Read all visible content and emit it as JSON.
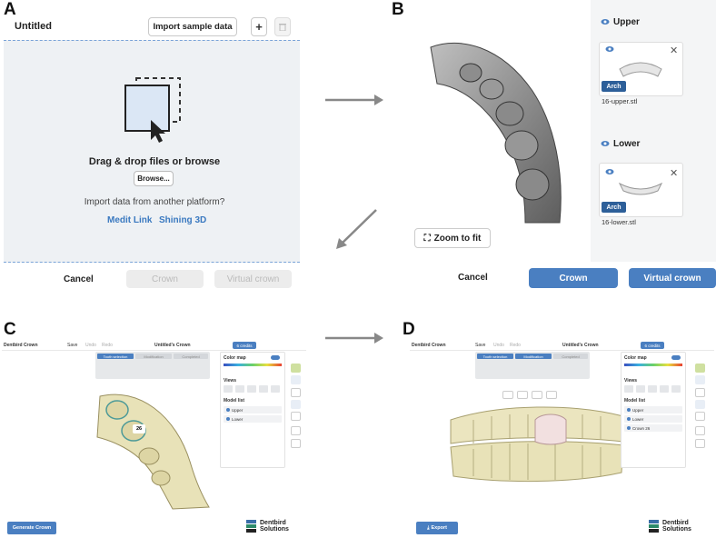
{
  "labels": {
    "a": "A",
    "b": "B",
    "c": "C",
    "d": "D"
  },
  "panel_a": {
    "title": "Untitled",
    "import_btn": "Import sample data",
    "plus": "+",
    "drag_text": "Drag & drop files or browse",
    "browse_btn": "Browse...",
    "another_text": "Import data from another platform?",
    "link1": "Medit Link",
    "link2": "Shining 3D",
    "cancel": "Cancel",
    "crown": "Crown",
    "virtual_crown": "Virtual crown"
  },
  "panel_b": {
    "upper_head": "Upper",
    "lower_head": "Lower",
    "arch": "Arch",
    "upper_file": "16-upper.stl",
    "lower_file": "16-lower.stl",
    "zoom": "Zoom to fit",
    "cancel": "Cancel",
    "crown": "Crown",
    "virtual_crown": "Virtual crown"
  },
  "panel_c": {
    "logo": "Dentbird Crown",
    "save": "Save",
    "undo": "Undo",
    "redo": "Redo",
    "title": "Untitled's Crown",
    "credit": "6 credits",
    "step1": "Tooth selection",
    "step2": "Modification",
    "step3": "Completed",
    "color_map": "Color map",
    "views": "Views",
    "model_list": "Model list",
    "models": [
      "Upper",
      "Lower"
    ],
    "tooth_num": "26",
    "generate": "Generate Crown",
    "brand1": "Dentbird",
    "brand2": "Solutions"
  },
  "panel_d": {
    "logo": "Dentbird Crown",
    "save": "Save",
    "undo": "Undo",
    "redo": "Redo",
    "title": "Untitled's Crown",
    "credit": "6 credits",
    "step1": "Tooth selection",
    "step2": "Modification",
    "step3": "Completed",
    "color_map": "Color map",
    "views": "Views",
    "model_list": "Model list",
    "models": [
      "Upper",
      "Lower",
      "Crown 26"
    ],
    "export": "Export",
    "brand1": "Dentbird",
    "brand2": "Solutions"
  },
  "colors": {
    "accent": "#4a7fc1",
    "link": "#3a79c0",
    "disabled_bg": "#ececec",
    "drop_bg": "#eef1f4"
  }
}
